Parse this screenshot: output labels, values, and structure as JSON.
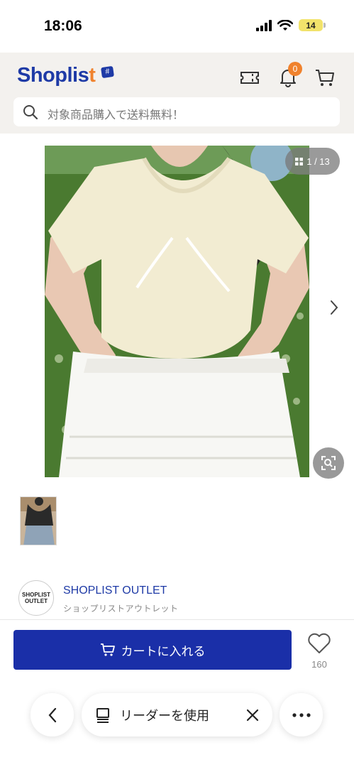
{
  "status": {
    "time": "18:06",
    "battery": "14"
  },
  "header": {
    "logo_main": "Shoplis",
    "logo_st": "t",
    "logo_badge": "#",
    "notification_count": "0",
    "search_placeholder": "対象商品購入で送料無料！"
  },
  "gallery": {
    "counter": "1 / 13"
  },
  "shop": {
    "avatar_line1": "SHOPLIST",
    "avatar_line2": "OUTLET",
    "name": "SHOPLIST OUTLET",
    "subtitle": "ショップリストアウトレット"
  },
  "cart": {
    "label": "カートに入れる",
    "favorite_count": "160"
  },
  "browser": {
    "reader_label": "リーダーを使用"
  },
  "colors": {
    "brand_blue": "#1a2fa8",
    "accent_orange": "#f0822d",
    "header_bg": "#f3f1ee"
  }
}
